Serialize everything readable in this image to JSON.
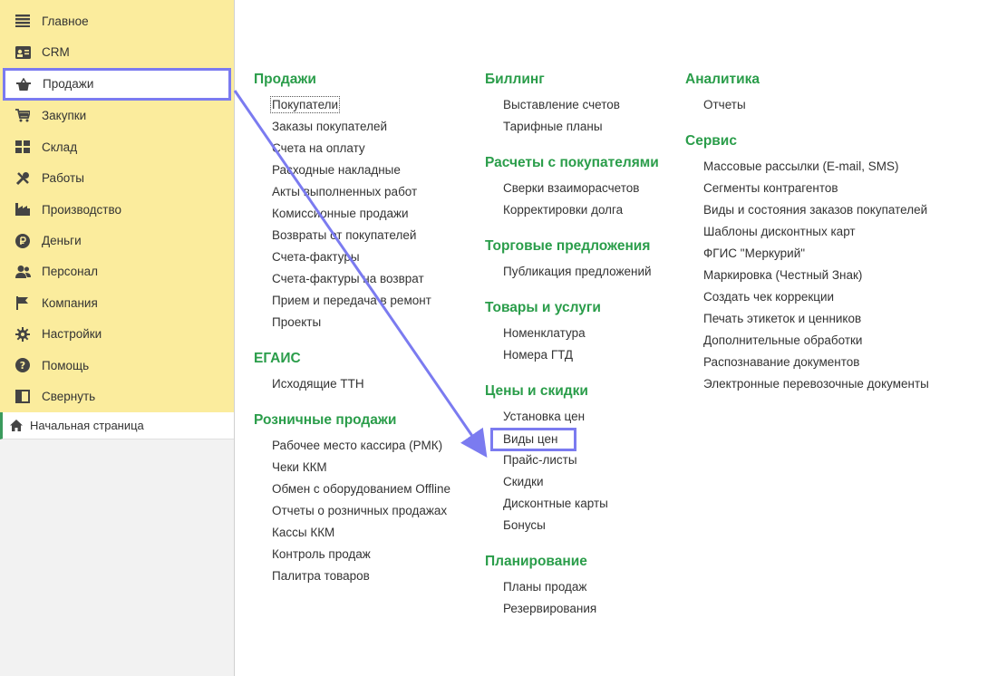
{
  "sidebar": {
    "items": [
      {
        "label": "Главное",
        "icon": "menu-lines-icon"
      },
      {
        "label": "CRM",
        "icon": "contact-card-icon"
      },
      {
        "label": "Продажи",
        "icon": "shop-basket-icon"
      },
      {
        "label": "Закупки",
        "icon": "cart-icon"
      },
      {
        "label": "Склад",
        "icon": "warehouse-grid-icon"
      },
      {
        "label": "Работы",
        "icon": "tools-icon"
      },
      {
        "label": "Производство",
        "icon": "factory-icon"
      },
      {
        "label": "Деньги",
        "icon": "ruble-coin-icon"
      },
      {
        "label": "Персонал",
        "icon": "people-icon"
      },
      {
        "label": "Компания",
        "icon": "flag-icon"
      },
      {
        "label": "Настройки",
        "icon": "gear-icon"
      },
      {
        "label": "Помощь",
        "icon": "help-icon"
      },
      {
        "label": "Свернуть",
        "icon": "collapse-panel-icon"
      }
    ],
    "active_index": 2,
    "home": {
      "label": "Начальная страница",
      "icon": "home-icon"
    }
  },
  "columns": [
    {
      "groups": [
        {
          "title": "Продажи",
          "items": [
            "Покупатели",
            "Заказы покупателей",
            "Счета на оплату",
            "Расходные накладные",
            "Акты выполненных работ",
            "Комиссионные продажи",
            "Возвраты от покупателей",
            "Счета-фактуры",
            "Счета-фактуры на возврат",
            "Прием и передача в ремонт",
            "Проекты"
          ]
        },
        {
          "title": "ЕГАИС",
          "items": [
            "Исходящие ТТН"
          ]
        },
        {
          "title": "Розничные продажи",
          "items": [
            "Рабочее место кассира (РМК)",
            "Чеки ККМ",
            "Обмен с оборудованием Offline",
            "Отчеты о розничных продажах",
            "Кассы ККМ",
            "Контроль продаж",
            "Палитра товаров"
          ]
        }
      ]
    },
    {
      "groups": [
        {
          "title": "Биллинг",
          "items": [
            "Выставление счетов",
            "Тарифные планы"
          ]
        },
        {
          "title": "Расчеты с покупателями",
          "items": [
            "Сверки взаиморасчетов",
            "Корректировки долга"
          ]
        },
        {
          "title": "Торговые предложения",
          "items": [
            "Публикация предложений"
          ]
        },
        {
          "title": "Товары и услуги",
          "items": [
            "Номенклатура",
            "Номера ГТД"
          ]
        },
        {
          "title": "Цены и скидки",
          "items": [
            "Установка цен",
            "Виды цен",
            "Прайс-листы",
            "Скидки",
            "Дисконтные карты",
            "Бонусы"
          ]
        },
        {
          "title": "Планирование",
          "items": [
            "Планы продаж",
            "Резервирования"
          ]
        }
      ]
    },
    {
      "groups": [
        {
          "title": "Аналитика",
          "items": [
            "Отчеты"
          ]
        },
        {
          "title": "Сервис",
          "items": [
            "Массовые рассылки (E-mail, SMS)",
            "Сегменты контрагентов",
            "Виды и состояния заказов покупателей",
            "Шаблоны дисконтных карт",
            "ФГИС \"Меркурий\"",
            "Маркировка (Честный Знак)",
            "Создать чек коррекции",
            "Печать этикеток и ценников",
            "Дополнительные обработки",
            "Распознавание документов",
            "Электронные перевозочные документы"
          ]
        }
      ]
    }
  ],
  "focused_item": "Покупатели",
  "highlighted_item": "Виды цен",
  "colors": {
    "sidebar_bg": "#fbec9d",
    "group_title": "#2a9d4a",
    "highlight": "#7b7bf0"
  }
}
